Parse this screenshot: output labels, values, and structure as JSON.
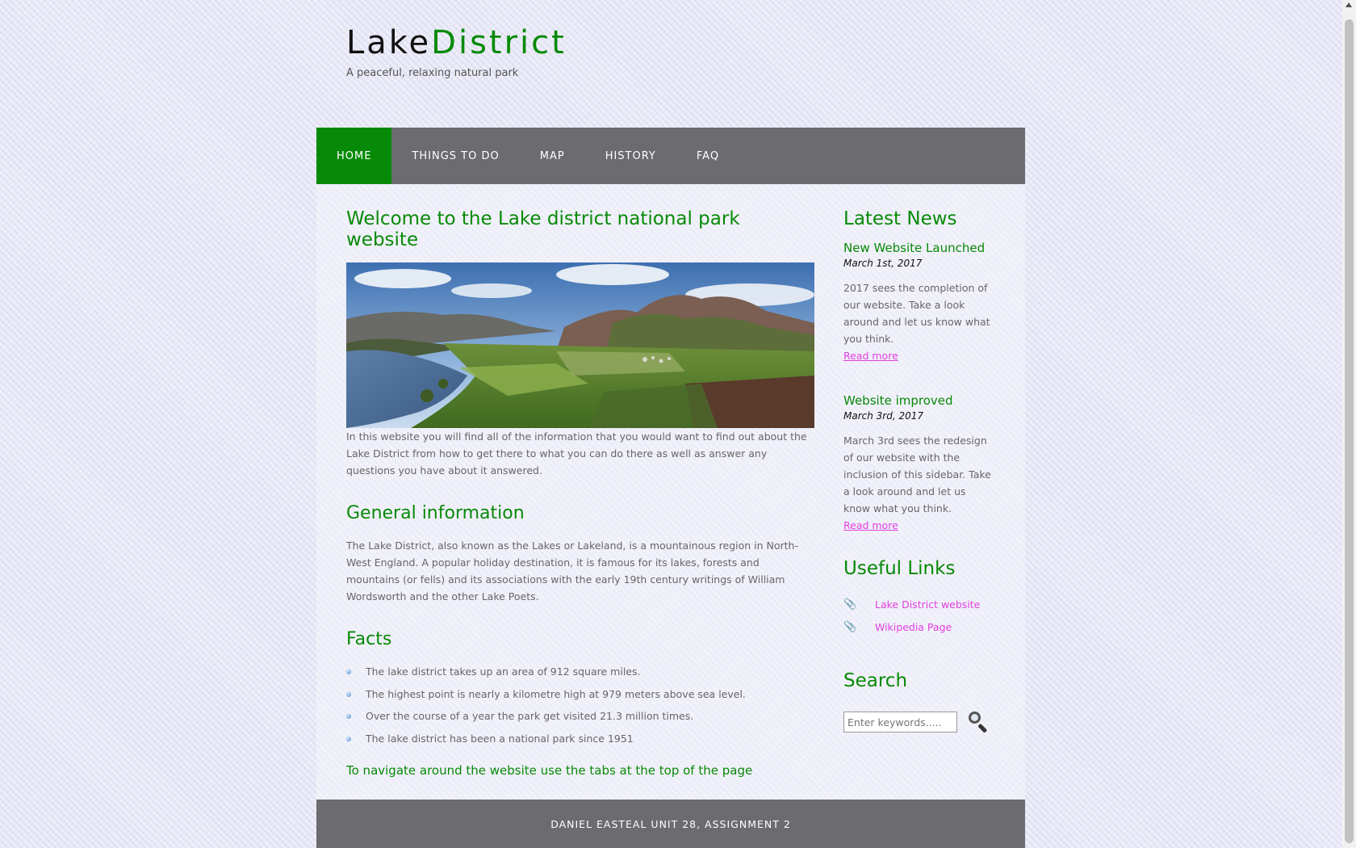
{
  "site": {
    "logo_part1": "Lake",
    "logo_part2": "District",
    "slogan": "A peaceful, relaxing natural park"
  },
  "nav": {
    "items": [
      {
        "label": "HOME",
        "active": true
      },
      {
        "label": "THINGS TO DO"
      },
      {
        "label": "MAP"
      },
      {
        "label": "HISTORY"
      },
      {
        "label": "FAQ"
      }
    ]
  },
  "main": {
    "title": "Welcome to the Lake district national park website",
    "intro": "In this website you will find all of the information that you would want to find out about the Lake District from how to get there to what you can do there as well as answer any questions you have about it answered.",
    "general_heading": "General information",
    "general_text": "The Lake District, also known as the Lakes or Lakeland, is a mountainous region in North-West England. A popular holiday destination, it is famous for its lakes, forests and mountains (or fells) and its associations with the early 19th century writings of William Wordsworth and the other Lake Poets.",
    "facts_heading": "Facts",
    "facts": [
      "The lake district takes up an area of 912 square miles.",
      "The highest point is nearly a kilometre high at 979 meters above sea level.",
      "Over the course of a year the park get visited 21.3 million times.",
      "The lake district has been a national park since 1951"
    ],
    "nav_hint": "To navigate around the website use the tabs at the top of the page"
  },
  "sidebar": {
    "news_heading": "Latest News",
    "news": [
      {
        "title": "New Website Launched",
        "date": "March 1st, 2017",
        "text": "2017 sees the completion of our website. Take a look around and let us know what you think.",
        "link": "Read more"
      },
      {
        "title": "Website improved",
        "date": "March 3rd, 2017",
        "text": "March 3rd sees the redesign of our website with the inclusion of this sidebar. Take a look around and let us know what you think.",
        "link": "Read more"
      }
    ],
    "links_heading": "Useful Links",
    "links": [
      "Lake District website",
      "Wikipedia Page"
    ],
    "search_heading": "Search",
    "search_placeholder": "Enter keywords....."
  },
  "footer": {
    "text": "DANIEL EASTEAL UNIT 28, ASSIGNMENT 2"
  },
  "colors": {
    "accent": "#078a07",
    "nav_bg": "#6b6b70",
    "link": "#e040e0"
  }
}
